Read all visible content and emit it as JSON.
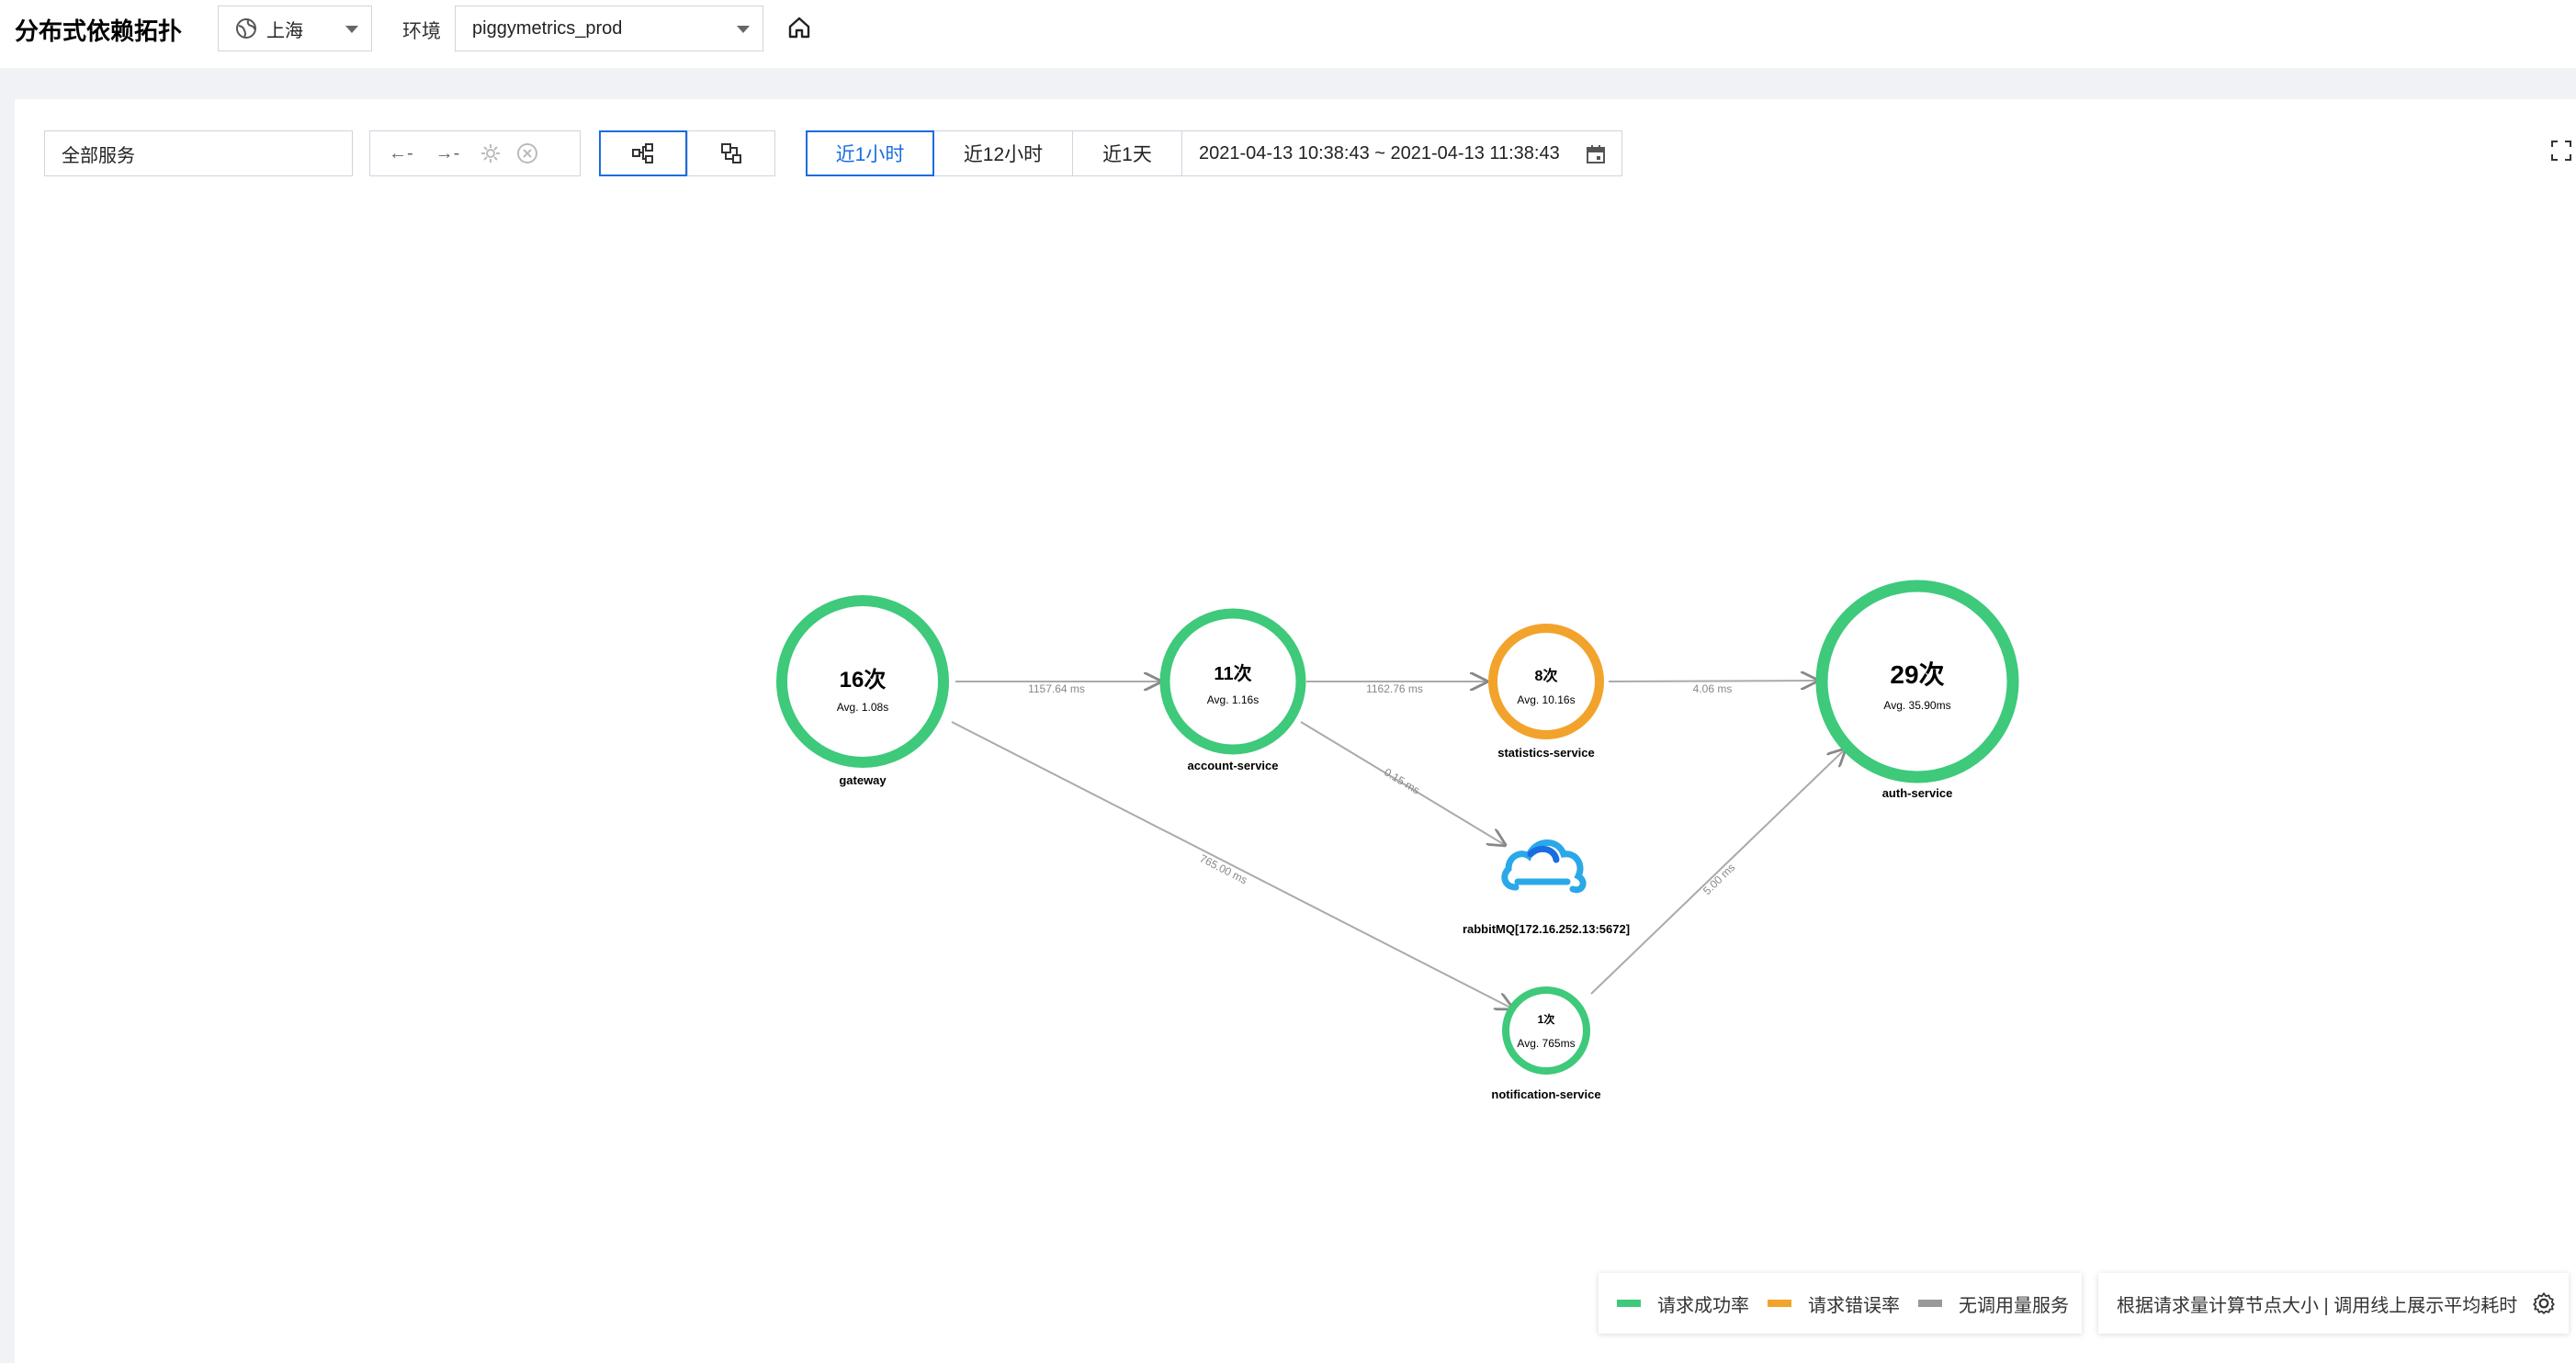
{
  "header": {
    "title": "分布式依赖拓扑",
    "region": "上海",
    "env_label": "环境",
    "env_value": "piggymetrics_prod"
  },
  "toolbar": {
    "service_filter": "全部服务",
    "upstream": "←-",
    "downstream": "→-",
    "time_options": [
      "近1小时",
      "近12小时",
      "近1天"
    ],
    "active_time": "近1小时",
    "date_range": "2021-04-13 10:38:43 ~ 2021-04-13 11:38:43"
  },
  "graph": {
    "nodes": [
      {
        "id": "gateway",
        "count": "16次",
        "avg": "Avg. 1.08s",
        "label": "gateway",
        "status": "success"
      },
      {
        "id": "account",
        "count": "11次",
        "avg": "Avg. 1.16s",
        "label": "account-service",
        "status": "success"
      },
      {
        "id": "statistics",
        "count": "8次",
        "avg": "Avg. 10.16s",
        "label": "statistics-service",
        "status": "error"
      },
      {
        "id": "auth",
        "count": "29次",
        "avg": "Avg. 35.90ms",
        "label": "auth-service",
        "status": "success"
      },
      {
        "id": "notification",
        "count": "1次",
        "avg": "Avg. 765ms",
        "label": "notification-service",
        "status": "success"
      },
      {
        "id": "rabbitmq",
        "label": "rabbitMQ[172.16.252.13:5672]",
        "status": "mq"
      }
    ],
    "edges": [
      {
        "from": "gateway",
        "to": "account",
        "label": "1157.64 ms"
      },
      {
        "from": "account",
        "to": "statistics",
        "label": "1162.76 ms"
      },
      {
        "from": "statistics",
        "to": "auth",
        "label": "4.06 ms"
      },
      {
        "from": "account",
        "to": "rabbitmq",
        "label": "0.15 ms"
      },
      {
        "from": "gateway",
        "to": "notification",
        "label": "765.00 ms"
      },
      {
        "from": "notification",
        "to": "auth",
        "label": "5.00 ms"
      }
    ]
  },
  "legend": {
    "items": [
      {
        "label": "请求成功率",
        "color": "#3ec97b"
      },
      {
        "label": "请求错误率",
        "color": "#f2a32c"
      },
      {
        "label": "无调用量服务",
        "color": "#999999"
      }
    ],
    "note": "根据请求量计算节点大小 | 调用线上展示平均耗时"
  },
  "colors": {
    "success": "#3ec97b",
    "error": "#f2a32c",
    "accent": "#1a6de0"
  }
}
